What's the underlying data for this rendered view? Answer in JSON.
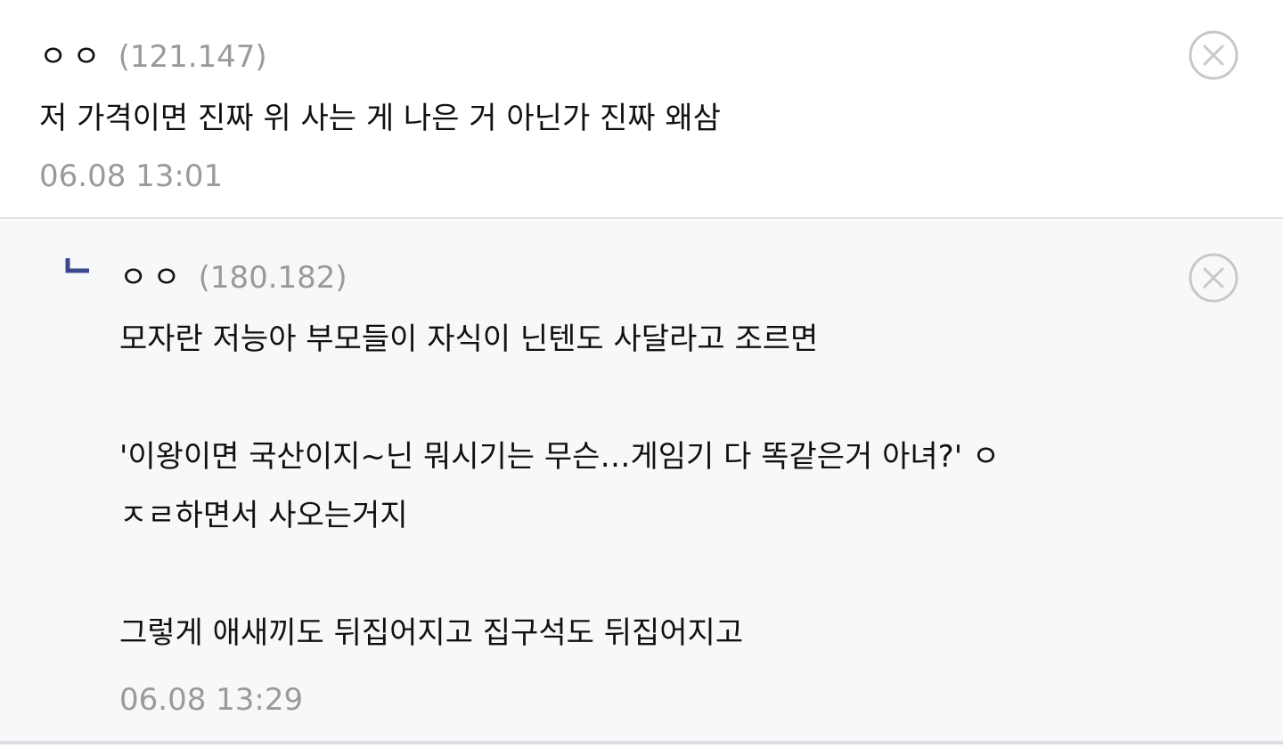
{
  "comments": [
    {
      "nickname": "ㅇㅇ",
      "ip": "(121.147)",
      "text": "저 가격이면 진짜 위 사는 게 나은 거 아닌가 진짜 왜삼",
      "timestamp": "06.08 13:01",
      "delete_icon": "close-circle-icon"
    }
  ],
  "reply": {
    "reply_icon": "reply-arrow-icon",
    "nickname": "ㅇㅇ",
    "ip": "(180.182)",
    "text": "모자란 저능아 부모들이 자식이 닌텐도 사달라고 조르면\n\n'이왕이면 국산이지~닌 뭐시기는 무슨…게임기 다 똑같은거 아녀?' ㅇ\nㅈㄹ하면서 사오는거지\n\n그렇게 애새끼도 뒤집어지고 집구석도 뒤집어지고",
    "timestamp": "06.08 13:29",
    "delete_icon": "close-circle-icon"
  },
  "colors": {
    "reply_bg": "#f7f8fa",
    "divider": "#dcdde3",
    "meta_gray": "#9a9a9a",
    "reply_icon": "#3b4890"
  }
}
